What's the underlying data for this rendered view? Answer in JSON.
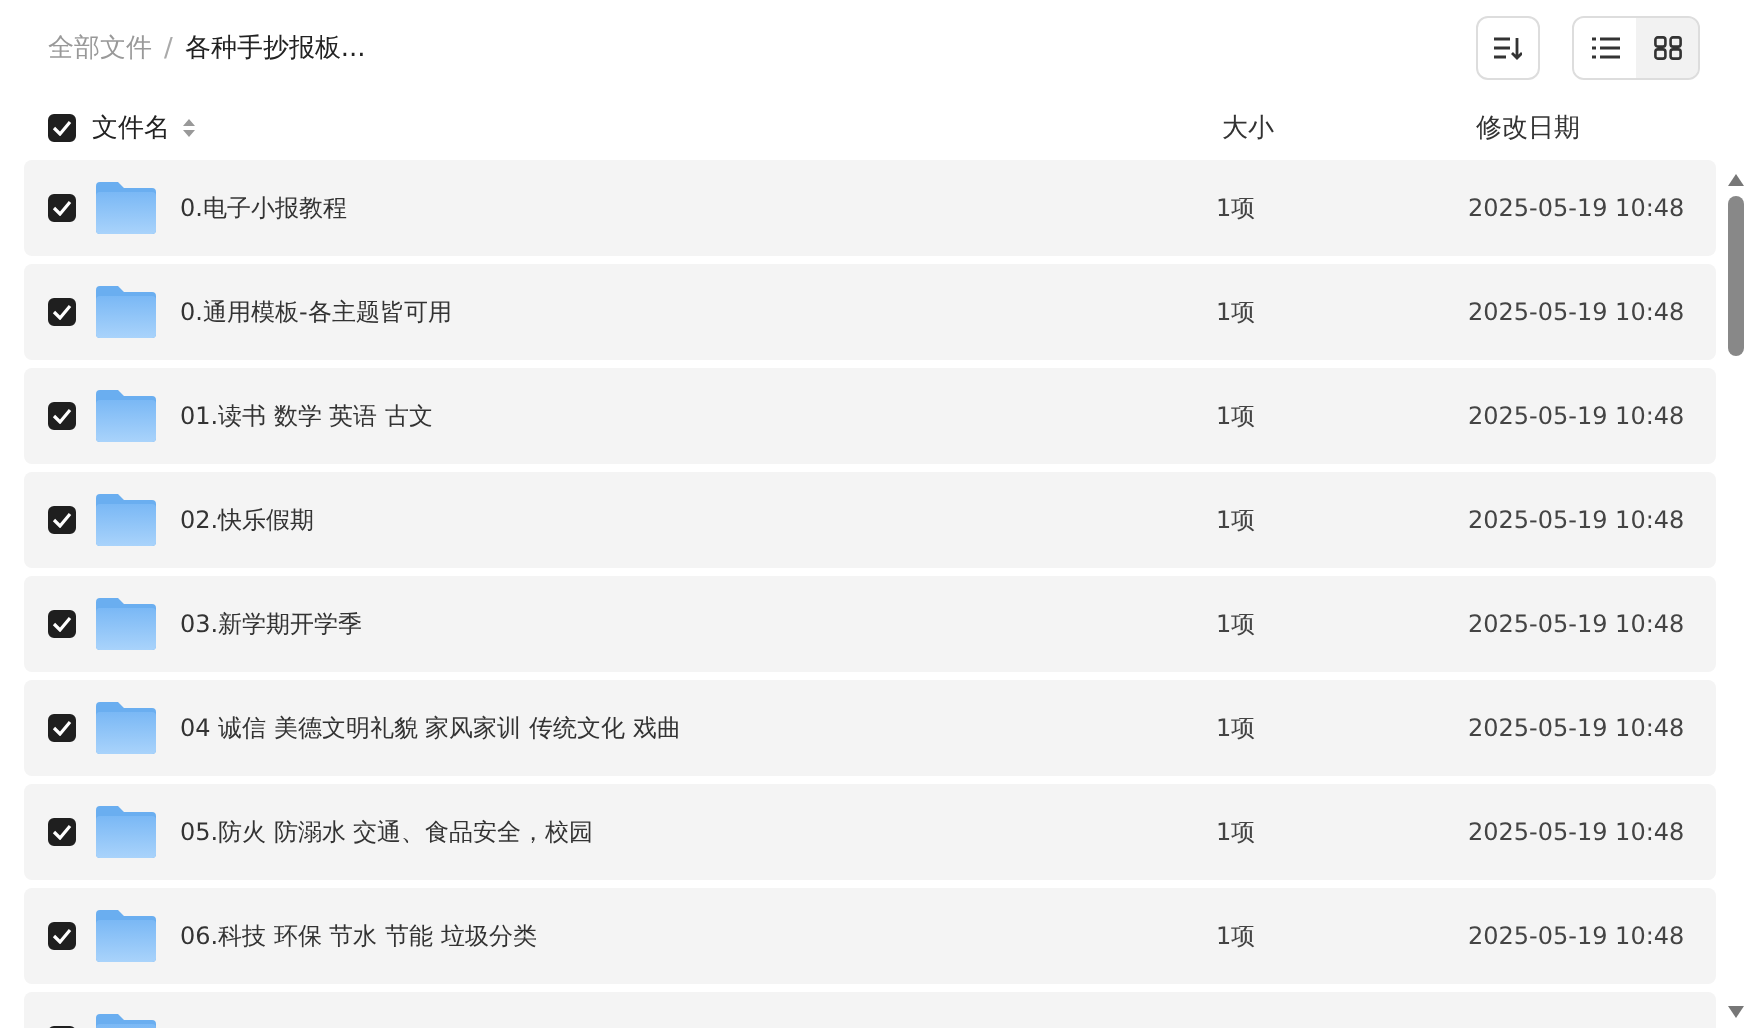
{
  "breadcrumb_separator": "/",
  "breadcrumb": [
    {
      "label": "全部文件",
      "current": false
    },
    {
      "label": "各种手抄报板...",
      "current": true
    }
  ],
  "view_toggle": [
    {
      "kind": "list",
      "selected": true
    },
    {
      "kind": "grid",
      "selected": false
    }
  ],
  "table": {
    "select_all": {
      "checked": true
    },
    "columns": [
      {
        "label": "文件名",
        "sortable": true
      },
      {
        "label": "大小",
        "sortable": false
      },
      {
        "label": "修改日期",
        "sortable": false
      }
    ],
    "rows": [
      {
        "checked": true,
        "name": "0.电子小报教程",
        "size": "1项",
        "modified": "2025-05-19 10:48"
      },
      {
        "checked": true,
        "name": "0.通用模板-各主题皆可用",
        "size": "1项",
        "modified": "2025-05-19 10:48"
      },
      {
        "checked": true,
        "name": "01.读书 数学 英语 古文",
        "size": "1项",
        "modified": "2025-05-19 10:48"
      },
      {
        "checked": true,
        "name": "02.快乐假期",
        "size": "1项",
        "modified": "2025-05-19 10:48"
      },
      {
        "checked": true,
        "name": "03.新学期开学季",
        "size": "1项",
        "modified": "2025-05-19 10:48"
      },
      {
        "checked": true,
        "name": "04 诚信 美德文明礼貌 家风家训 传统文化 戏曲",
        "size": "1项",
        "modified": "2025-05-19 10:48"
      },
      {
        "checked": true,
        "name": "05.防火 防溺水 交通、食品安全，校园",
        "size": "1项",
        "modified": "2025-05-19 10:48"
      },
      {
        "checked": true,
        "name": "06.科技 环保 节水 节能 垃圾分类",
        "size": "1项",
        "modified": "2025-05-19 10:48"
      },
      {
        "checked": true
      }
    ]
  }
}
